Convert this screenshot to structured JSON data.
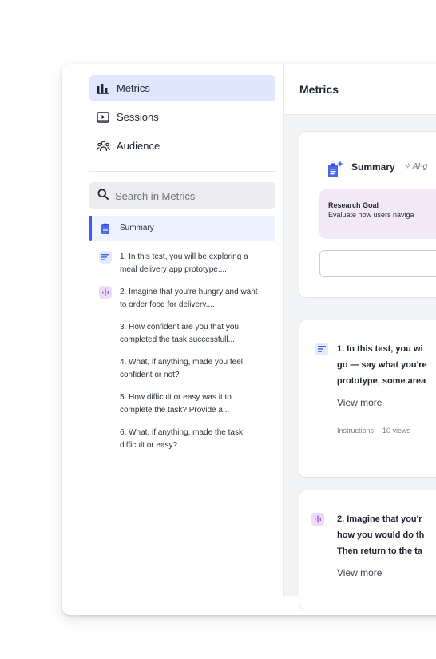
{
  "sidebar": {
    "nav": [
      {
        "label": "Metrics",
        "icon": "bar-chart-icon",
        "active": true
      },
      {
        "label": "Sessions",
        "icon": "play-session-icon",
        "active": false
      },
      {
        "label": "Audience",
        "icon": "audience-icon",
        "active": false
      }
    ],
    "search": {
      "placeholder": "Search in Metrics"
    },
    "questions": [
      {
        "label": "Summary",
        "icon": "clipboard-icon"
      },
      {
        "label": "1. In this test, you will be exploring a meal delivery app prototype....",
        "icon": "text-lines-icon"
      },
      {
        "label": "2. Imagine that you're hungry and want to order food for delivery....",
        "icon": "audio-wave-icon"
      },
      {
        "label": "3. How confident are you that you completed the task successfull...",
        "icon": ""
      },
      {
        "label": "4. What, if anything, made you feel confident or not?",
        "icon": ""
      },
      {
        "label": "5. How difficult or easy was it to complete the task? Provide a...",
        "icon": ""
      },
      {
        "label": "6. What, if anything, made the task difficult or easy?",
        "icon": ""
      }
    ]
  },
  "main": {
    "title": "Metrics",
    "summary_card": {
      "title": "Summary",
      "ai_tag": "✧ AI-g",
      "goal_title": "Research Goal",
      "goal_text": "Evaluate how users naviga"
    },
    "task_cards": [
      {
        "lines": [
          "1. In this test, you wi",
          "go — say what you're",
          "prototype, some area"
        ],
        "view_more": "View more",
        "meta_type": "Instructions",
        "meta_views": "10 views"
      },
      {
        "lines": [
          "2. Imagine that you'r",
          "how you would do th",
          "Then return to the ta"
        ],
        "view_more": "View more"
      }
    ]
  },
  "colors": {
    "accent": "#3d5cf5",
    "active_bg": "#dfe6fd",
    "goal_bg": "#f1e8f8",
    "audio_icon_bg": "#ecdcf7"
  }
}
